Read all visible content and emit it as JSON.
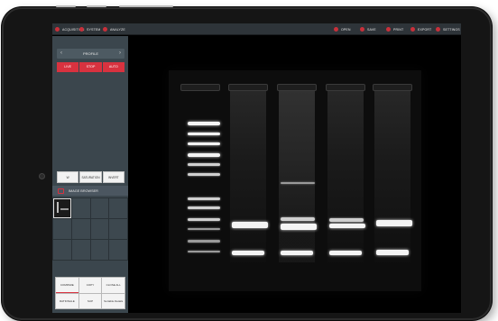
{
  "toolbar": {
    "left": [
      {
        "label": "ACQUISITION",
        "icon": "camera-icon"
      },
      {
        "label": "SYSTEM",
        "icon": "system-icon"
      },
      {
        "label": "ANALYZE",
        "icon": "analyze-icon"
      }
    ],
    "right": [
      {
        "label": "OPEN",
        "icon": "folder-icon"
      },
      {
        "label": "SAVE",
        "icon": "save-icon"
      },
      {
        "label": "PRINT",
        "icon": "print-icon"
      },
      {
        "label": "EXPORT",
        "icon": "export-icon"
      },
      {
        "label": "SETTINGS",
        "icon": "gear-icon"
      }
    ]
  },
  "profile": {
    "label": "PROFILE"
  },
  "modes": [
    "LIVE",
    "STOP",
    "AUTO"
  ],
  "options": [
    "W",
    "SATURATION",
    "INVERT"
  ],
  "browser": {
    "title": "IMAGE BROWSER"
  },
  "bottom_buttons": [
    "COMPARE",
    "COPY",
    "CLOSE ALL",
    "RATIONALE",
    "SUP",
    "Sortable Details"
  ],
  "colors": {
    "accent": "#d8323f",
    "panel": "#3b464d",
    "toolbar": "#2e3439",
    "gel_band": "#f4f4f4"
  }
}
